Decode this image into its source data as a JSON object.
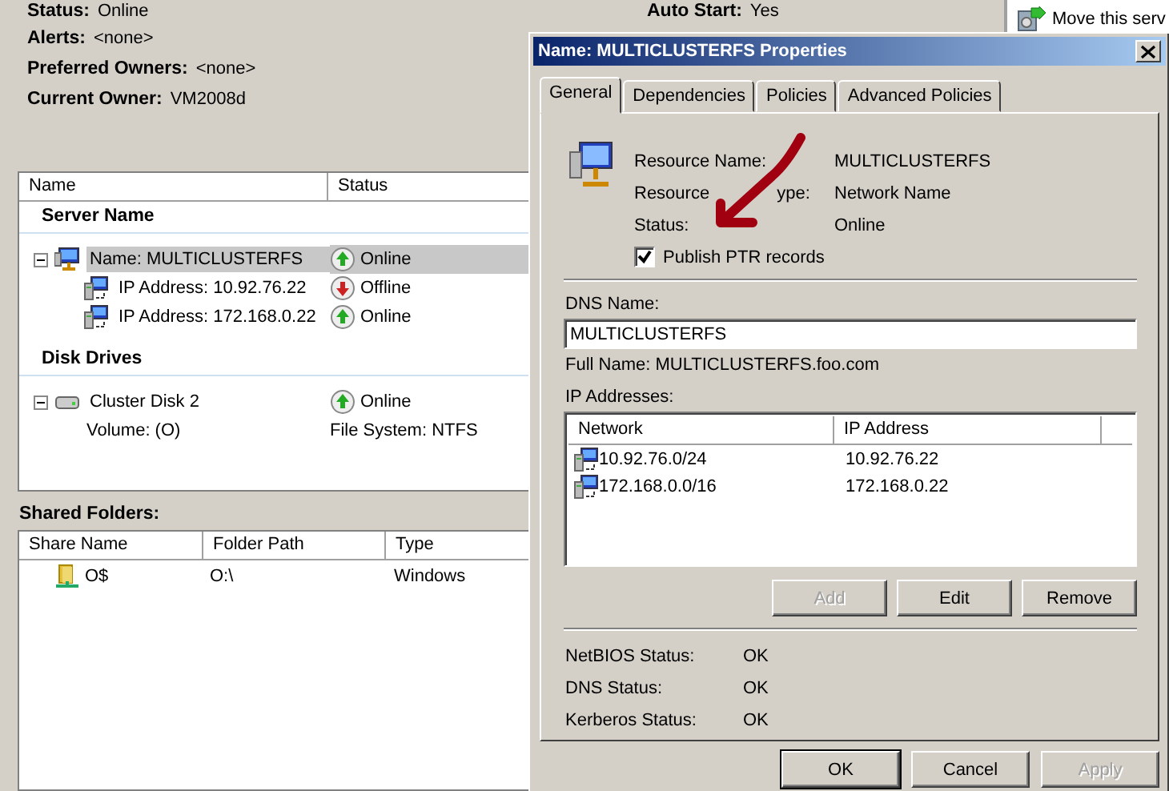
{
  "summary": [
    {
      "label": "Status:",
      "value": "Online"
    },
    {
      "label": "Alerts:",
      "value": "<none>"
    },
    {
      "label": "Preferred Owners:",
      "value": "<none>"
    },
    {
      "label": "Current Owner:",
      "value": "VM2008d"
    }
  ],
  "summary_right": [
    {
      "label": "Auto Start:",
      "value": "Yes"
    }
  ],
  "actions": [
    {
      "label": "Move this serv"
    }
  ],
  "resources": {
    "columns": [
      "Name",
      "Status"
    ],
    "groups": [
      {
        "title": "Server Name",
        "items": [
          {
            "kind": "network-name",
            "name": "Name: MULTICLUSTERFS",
            "status": "Online",
            "online": true,
            "expanded": true,
            "selected": true,
            "children": [
              {
                "kind": "ip",
                "name": "IP Address: 10.92.76.22",
                "status": "Offline",
                "online": false,
                "selected": false
              },
              {
                "kind": "ip",
                "name": "IP Address: 172.168.0.22",
                "status": "Online",
                "online": true,
                "selected": false
              }
            ]
          }
        ]
      },
      {
        "title": "Disk Drives",
        "items": [
          {
            "kind": "disk",
            "name": "Cluster Disk 2",
            "status": "Online",
            "online": true,
            "expanded": true,
            "selected": false,
            "children": [
              {
                "kind": "detail",
                "name": "Volume: (O)",
                "status": "File System: NTFS",
                "selected": false
              }
            ]
          }
        ]
      }
    ]
  },
  "shared_folders": {
    "title": "Shared Folders:",
    "columns": [
      "Share Name",
      "Folder Path",
      "Type"
    ],
    "rows": [
      [
        "O$",
        "O:\\",
        "Windows"
      ]
    ]
  },
  "dialog": {
    "title": "Name: MULTICLUSTERFS Properties",
    "tabs": [
      {
        "label": "General",
        "selected": true
      },
      {
        "label": "Dependencies",
        "selected": false
      },
      {
        "label": "Policies",
        "selected": false
      },
      {
        "label": "Advanced Policies",
        "selected": false
      }
    ],
    "resource_info": [
      {
        "label": "Resource Name:",
        "value": "MULTICLUSTERFS"
      },
      {
        "label_parts": [
          "Resource",
          "ype:"
        ],
        "value": "Network Name"
      },
      {
        "label": "Status:",
        "value": "Online"
      }
    ],
    "publish_ptr": {
      "label": "Publish PTR records",
      "checked": true
    },
    "dns_name": {
      "label": "DNS Name:",
      "value": "MULTICLUSTERFS"
    },
    "full_name": "Full Name: MULTICLUSTERFS.foo.com",
    "ip_addresses": {
      "label": "IP Addresses:",
      "columns": [
        "Network",
        "IP Address"
      ],
      "rows": [
        [
          "10.92.76.0/24",
          "10.92.76.22"
        ],
        [
          "172.168.0.0/16",
          "172.168.0.22"
        ]
      ]
    },
    "ip_buttons": [
      {
        "label": "Add",
        "disabled": true
      },
      {
        "label": "Edit",
        "disabled": false
      },
      {
        "label": "Remove",
        "disabled": false
      }
    ],
    "statuses": [
      {
        "label": "NetBIOS Status:",
        "value": "OK"
      },
      {
        "label": "DNS Status:",
        "value": "OK"
      },
      {
        "label": "Kerberos Status:",
        "value": "OK"
      }
    ],
    "buttons": [
      {
        "label": "OK",
        "default": true,
        "disabled": false
      },
      {
        "label": "Cancel",
        "default": false,
        "disabled": false
      },
      {
        "label": "Apply",
        "default": false,
        "disabled": true
      }
    ]
  }
}
